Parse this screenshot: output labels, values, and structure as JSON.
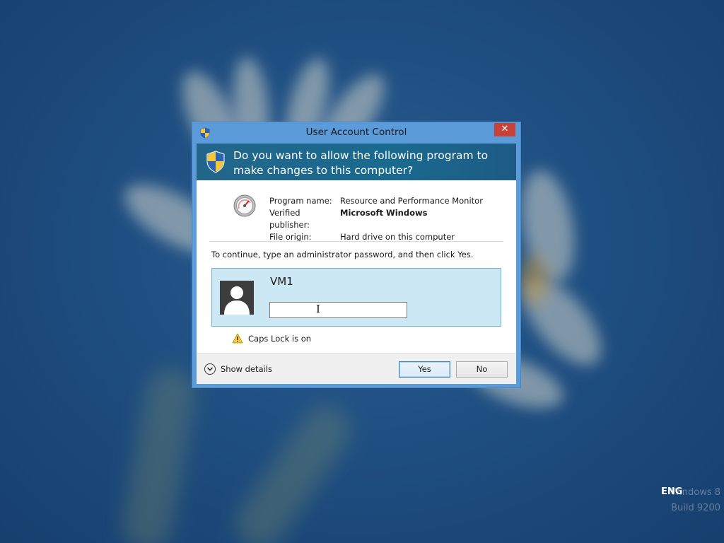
{
  "dialog": {
    "title": "User Account Control",
    "close_glyph": "✕",
    "question": "Do you want to allow the following program to make changes to this computer?",
    "program_info": [
      {
        "label": "Program name:",
        "value": "Resource and Performance Monitor",
        "bold": false
      },
      {
        "label": "Verified publisher:",
        "value": "Microsoft Windows",
        "bold": true
      },
      {
        "label": "File origin:",
        "value": "Hard drive on this computer",
        "bold": false
      }
    ],
    "instruction": "To continue, type an administrator password, and then click Yes.",
    "credential": {
      "user_name": "VM1",
      "password_value": "",
      "password_placeholder": ""
    },
    "caps_lock_warning": "Caps Lock is on",
    "show_details_label": "Show details",
    "yes_label": "Yes",
    "no_label": "No"
  },
  "taskbar": {
    "language": "ENG"
  },
  "watermark": {
    "line1": "Windows 8",
    "line2": "Build 9200"
  },
  "colors": {
    "desktop_blue": "#1f4f82",
    "dialog_frame": "#5b9bd9",
    "question_band": "#1a6a8f",
    "credential_tile": "#cde8f5",
    "close_button": "#c7423a"
  },
  "icons": [
    "uac-shield-icon",
    "close-icon",
    "performance-monitor-icon",
    "user-avatar-icon",
    "warning-icon",
    "chevron-down-icon",
    "text-cursor-icon"
  ]
}
